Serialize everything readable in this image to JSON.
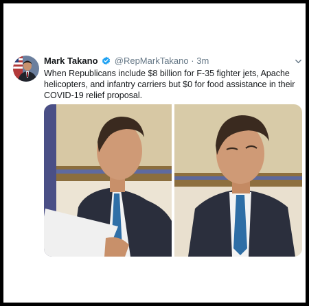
{
  "tweet": {
    "display_name": "Mark Takano",
    "handle": "@RepMarkTakano",
    "separator": "·",
    "time": "3m",
    "text": "When Republicans include $8 billion for F-35 fighter jets, Apache helicopters, and infantry carriers but $0 for food assistance in their COVID-19 relief proposal."
  },
  "colors": {
    "verified": "#1da1f2",
    "text": "#14171a",
    "muted": "#657786"
  },
  "icons": [
    "verified-badge-icon",
    "chevron-down-icon"
  ]
}
